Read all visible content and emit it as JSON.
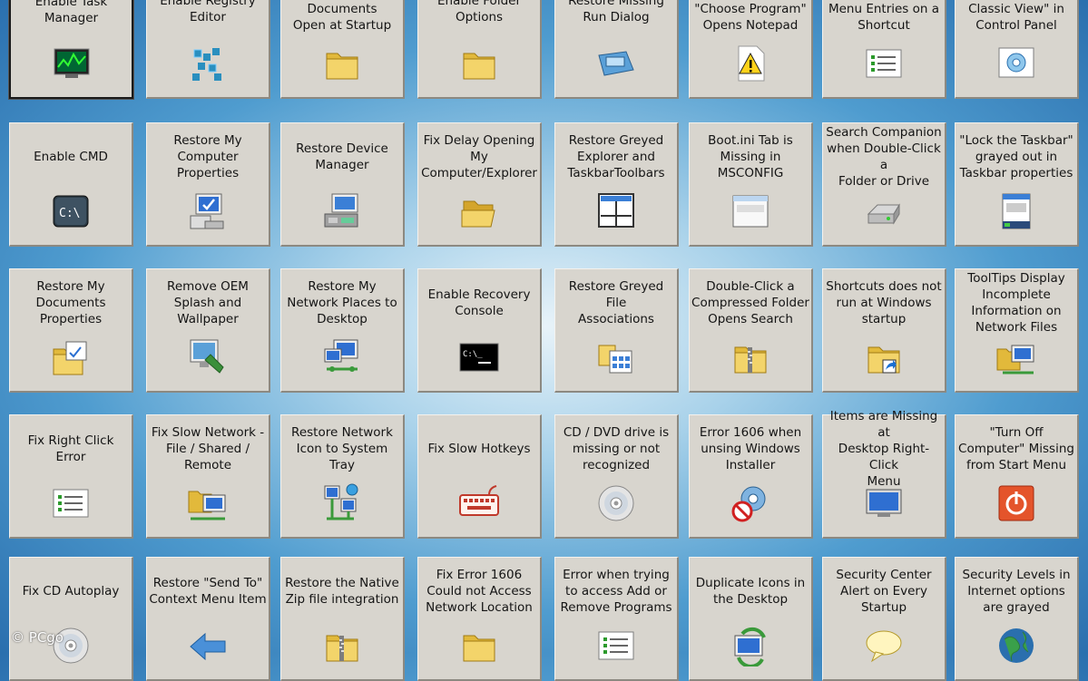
{
  "tiles": [
    {
      "label": "Enable Task\nManager",
      "icon": "task-manager-icon",
      "selected": true
    },
    {
      "label": "Enable Registry\nEditor",
      "icon": "registry-editor-icon"
    },
    {
      "label": "Stop My Documents\nOpen at Startup",
      "icon": "folder-icon"
    },
    {
      "label": "Enable Folder\nOptions",
      "icon": "folder-icon"
    },
    {
      "label": "Restore Missing\nRun Dialog",
      "icon": "run-dialog-icon"
    },
    {
      "label": "\"Open With\" or\n\"Choose Program\"\nOpens Notepad",
      "icon": "warning-icon"
    },
    {
      "label": "Duplicate Context\nMenu Entries on a\nShortcut",
      "icon": "list-icon"
    },
    {
      "label": "\"No \"Switch to\nClassic View\" in\nControl Panel",
      "icon": "control-panel-icon"
    },
    {
      "label": "Enable CMD",
      "icon": "cmd-icon"
    },
    {
      "label": "Restore My\nComputer\nProperties",
      "icon": "computer-properties-icon"
    },
    {
      "label": "Restore Device\nManager",
      "icon": "device-manager-icon"
    },
    {
      "label": "Fix Delay Opening\nMy\nComputer/Explorer",
      "icon": "open-folder-icon"
    },
    {
      "label": "Restore Greyed\nExplorer and\nTaskbarToolbars",
      "icon": "window-layout-icon"
    },
    {
      "label": "Boot.ini Tab is\nMissing in\nMSCONFIG",
      "icon": "window-icon"
    },
    {
      "label": "Search Companion\nwhen Double-Click a\nFolder or Drive",
      "icon": "drive-icon"
    },
    {
      "label": "\"Lock the Taskbar\"\ngrayed out in\nTaskbar properties",
      "icon": "taskbar-properties-icon"
    },
    {
      "label": "Restore My\nDocuments\nProperties",
      "icon": "documents-properties-icon"
    },
    {
      "label": "Remove OEM\nSplash and\nWallpaper",
      "icon": "wallpaper-icon"
    },
    {
      "label": "Restore My\nNetwork Places to\nDesktop",
      "icon": "network-places-icon"
    },
    {
      "label": "Enable Recovery\nConsole",
      "icon": "console-icon"
    },
    {
      "label": "Restore Greyed File\nAssociations",
      "icon": "file-associations-icon"
    },
    {
      "label": "Double-Click a\nCompressed Folder\nOpens Search",
      "icon": "zip-folder-icon"
    },
    {
      "label": "Shortcuts does not\nrun at Windows\nstartup",
      "icon": "shortcut-folder-icon"
    },
    {
      "label": "ToolTips Display\nIncomplete\nInformation on\nNetwork Files",
      "icon": "network-files-icon"
    },
    {
      "label": "Fix Right Click Error",
      "icon": "list-icon"
    },
    {
      "label": "Fix Slow Network -\nFile / Shared /\nRemote",
      "icon": "network-share-icon"
    },
    {
      "label": "Restore Network\nIcon to System\nTray",
      "icon": "network-tray-icon"
    },
    {
      "label": "Fix Slow Hotkeys",
      "icon": "keyboard-icon"
    },
    {
      "label": "CD / DVD drive is\nmissing or not\nrecognized",
      "icon": "cd-icon"
    },
    {
      "label": "Error 1606 when\nunsing Windows\nInstaller",
      "icon": "installer-error-icon"
    },
    {
      "label": "Items are Missing at\nDesktop Right-Click\nMenu",
      "icon": "monitor-icon"
    },
    {
      "label": "\"Turn Off\nComputer\" Missing\nfrom Start Menu",
      "icon": "power-icon"
    },
    {
      "label": "Fix CD Autoplay",
      "icon": "cd-icon"
    },
    {
      "label": "Restore \"Send To\"\nContext Menu Item",
      "icon": "arrow-left-icon"
    },
    {
      "label": "Restore the Native\nZip file integration",
      "icon": "zip-folder-icon"
    },
    {
      "label": "Fix Error 1606\nCould not Access\nNetwork Location",
      "icon": "folder-icon"
    },
    {
      "label": "Error when trying\nto access Add or\nRemove Programs",
      "icon": "list-icon"
    },
    {
      "label": "Duplicate Icons in\nthe Desktop",
      "icon": "refresh-icon"
    },
    {
      "label": "Security Center\nAlert on Every\nStartup",
      "icon": "alert-balloon-icon"
    },
    {
      "label": "Security Levels in\nInternet options\nare grayed",
      "icon": "globe-icon"
    }
  ],
  "watermark": "© PCgo",
  "colors": {
    "tile": "#d8d5ce",
    "background_center": "#e8f3f9",
    "background_edge": "#2a6fae"
  }
}
